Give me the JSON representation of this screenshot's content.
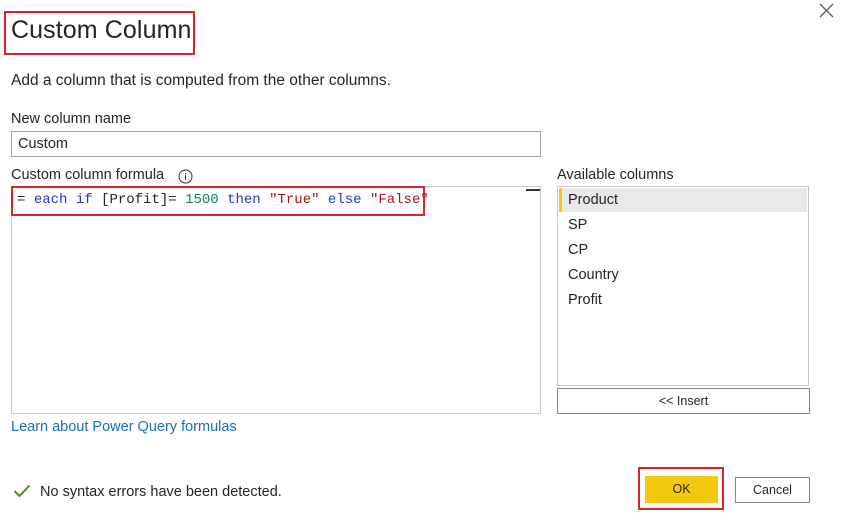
{
  "dialog": {
    "title": "Custom Column",
    "description": "Add a column that is computed from the other columns."
  },
  "new_column": {
    "label": "New column name",
    "value": "Custom"
  },
  "formula": {
    "label": "Custom column formula",
    "tokens": [
      {
        "text": "= ",
        "kind": "op"
      },
      {
        "text": "each",
        "kind": "kw"
      },
      {
        "text": " ",
        "kind": "op"
      },
      {
        "text": "if",
        "kind": "kw"
      },
      {
        "text": " [Profit]= ",
        "kind": "id"
      },
      {
        "text": "1500",
        "kind": "num"
      },
      {
        "text": " ",
        "kind": "op"
      },
      {
        "text": "then",
        "kind": "kw"
      },
      {
        "text": " ",
        "kind": "op"
      },
      {
        "text": "\"True\"",
        "kind": "str"
      },
      {
        "text": " ",
        "kind": "op"
      },
      {
        "text": "else",
        "kind": "kw"
      },
      {
        "text": " ",
        "kind": "op"
      },
      {
        "text": "\"False\"",
        "kind": "str"
      }
    ]
  },
  "available_columns": {
    "label": "Available columns",
    "items": [
      "Product",
      "SP",
      "CP",
      "Country",
      "Profit"
    ],
    "selected": "Product",
    "insert_label": "<< Insert"
  },
  "learn_link": "Learn about Power Query formulas",
  "status": {
    "text": "No syntax errors have been detected.",
    "icon": "checkmark-icon"
  },
  "buttons": {
    "ok": "OK",
    "cancel": "Cancel"
  },
  "colors": {
    "accent": "#f2c811",
    "highlight_border": "#d9242b",
    "link": "#1a6fb4",
    "success": "#498205"
  }
}
